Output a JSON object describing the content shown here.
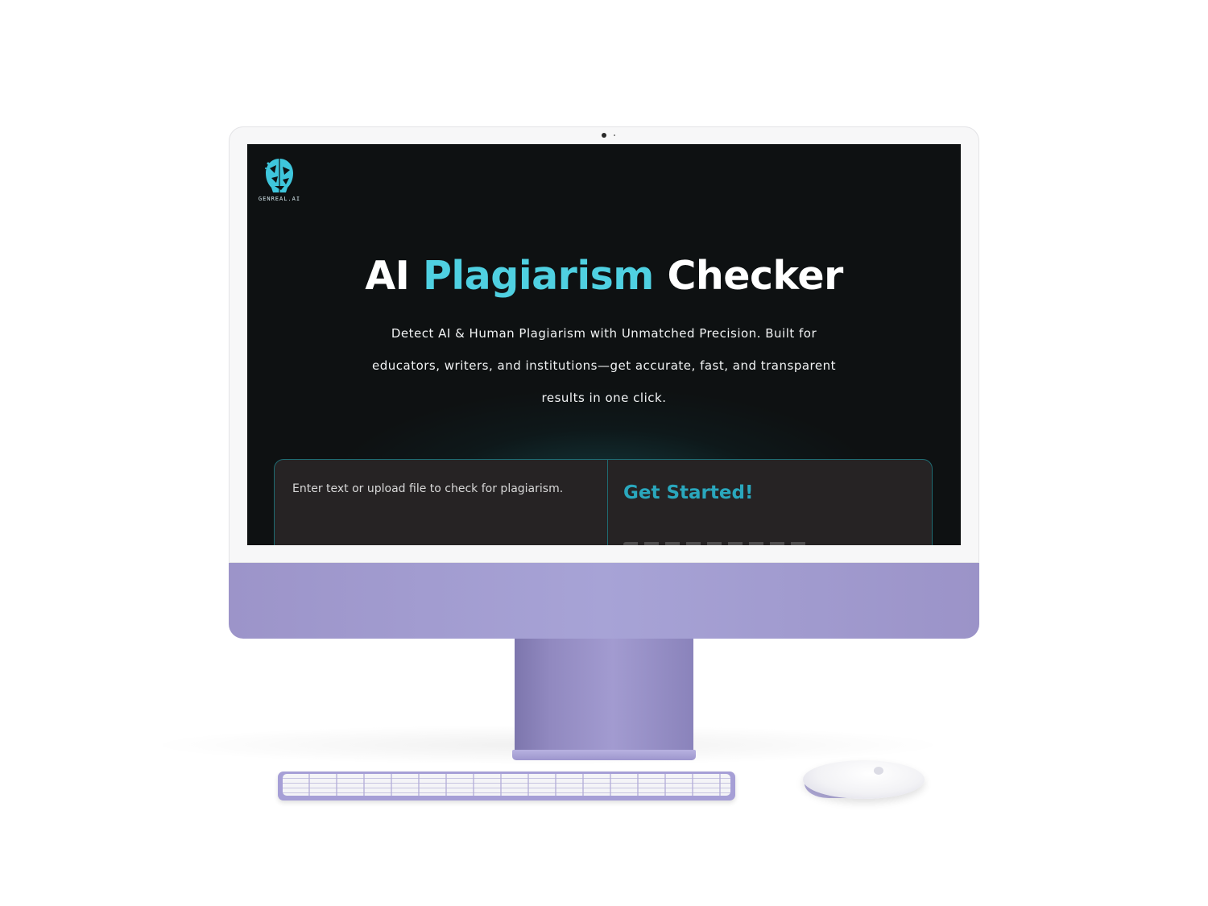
{
  "brand": {
    "logo_text": "GENREAL.AI",
    "accent_color": "#4fd0e1"
  },
  "hero": {
    "title_part1": "AI",
    "title_accent": "Plagiarism",
    "title_part2": "Checker",
    "subtitle": "Detect AI & Human Plagiarism with Unmatched Precision. Built for educators, writers, and institutions—get accurate, fast, and transparent results in one click."
  },
  "checker": {
    "input_placeholder": "Enter text or upload file to check for plagiarism.",
    "get_started_label": "Get Started!",
    "border_color": "#1f6b72"
  },
  "device": {
    "color": "#a7a3d6",
    "icons": [
      "camera-icon",
      "logo-face-icon"
    ]
  }
}
